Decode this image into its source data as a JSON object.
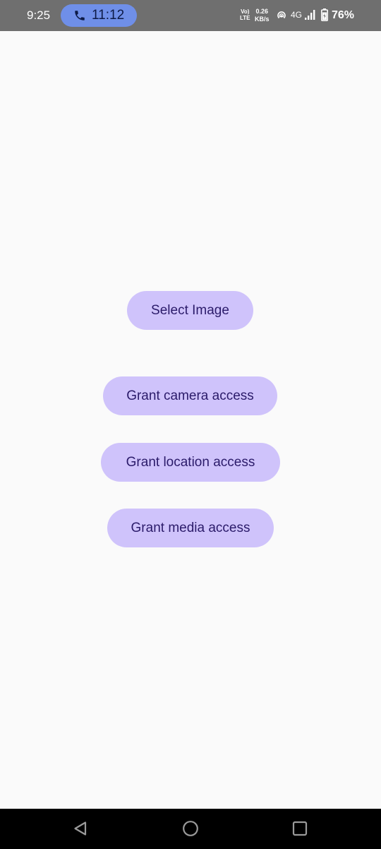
{
  "status_bar": {
    "time": "9:25",
    "call_chip": {
      "timer": "11:12",
      "icon": "phone-icon",
      "color": "#6f8fe8"
    },
    "volte_label_top": "Vo)",
    "volte_label_bottom": "LTE",
    "data_speed_value": "0.26",
    "data_speed_unit": "KB/s",
    "hotspot_icon": "hotspot-icon",
    "network_type": "4G",
    "signal_icon": "signal-icon",
    "battery_icon": "battery-charging-icon",
    "battery_percent": "76%"
  },
  "main": {
    "buttons": {
      "select_image": "Select Image",
      "grant_camera": "Grant camera access",
      "grant_location": "Grant location access",
      "grant_media": "Grant media access"
    },
    "button_color": "#cfc3fb",
    "button_text_color": "#2b1b6a"
  },
  "nav_bar": {
    "back_icon": "back-triangle-icon",
    "home_icon": "home-circle-icon",
    "recents_icon": "recents-square-icon"
  }
}
